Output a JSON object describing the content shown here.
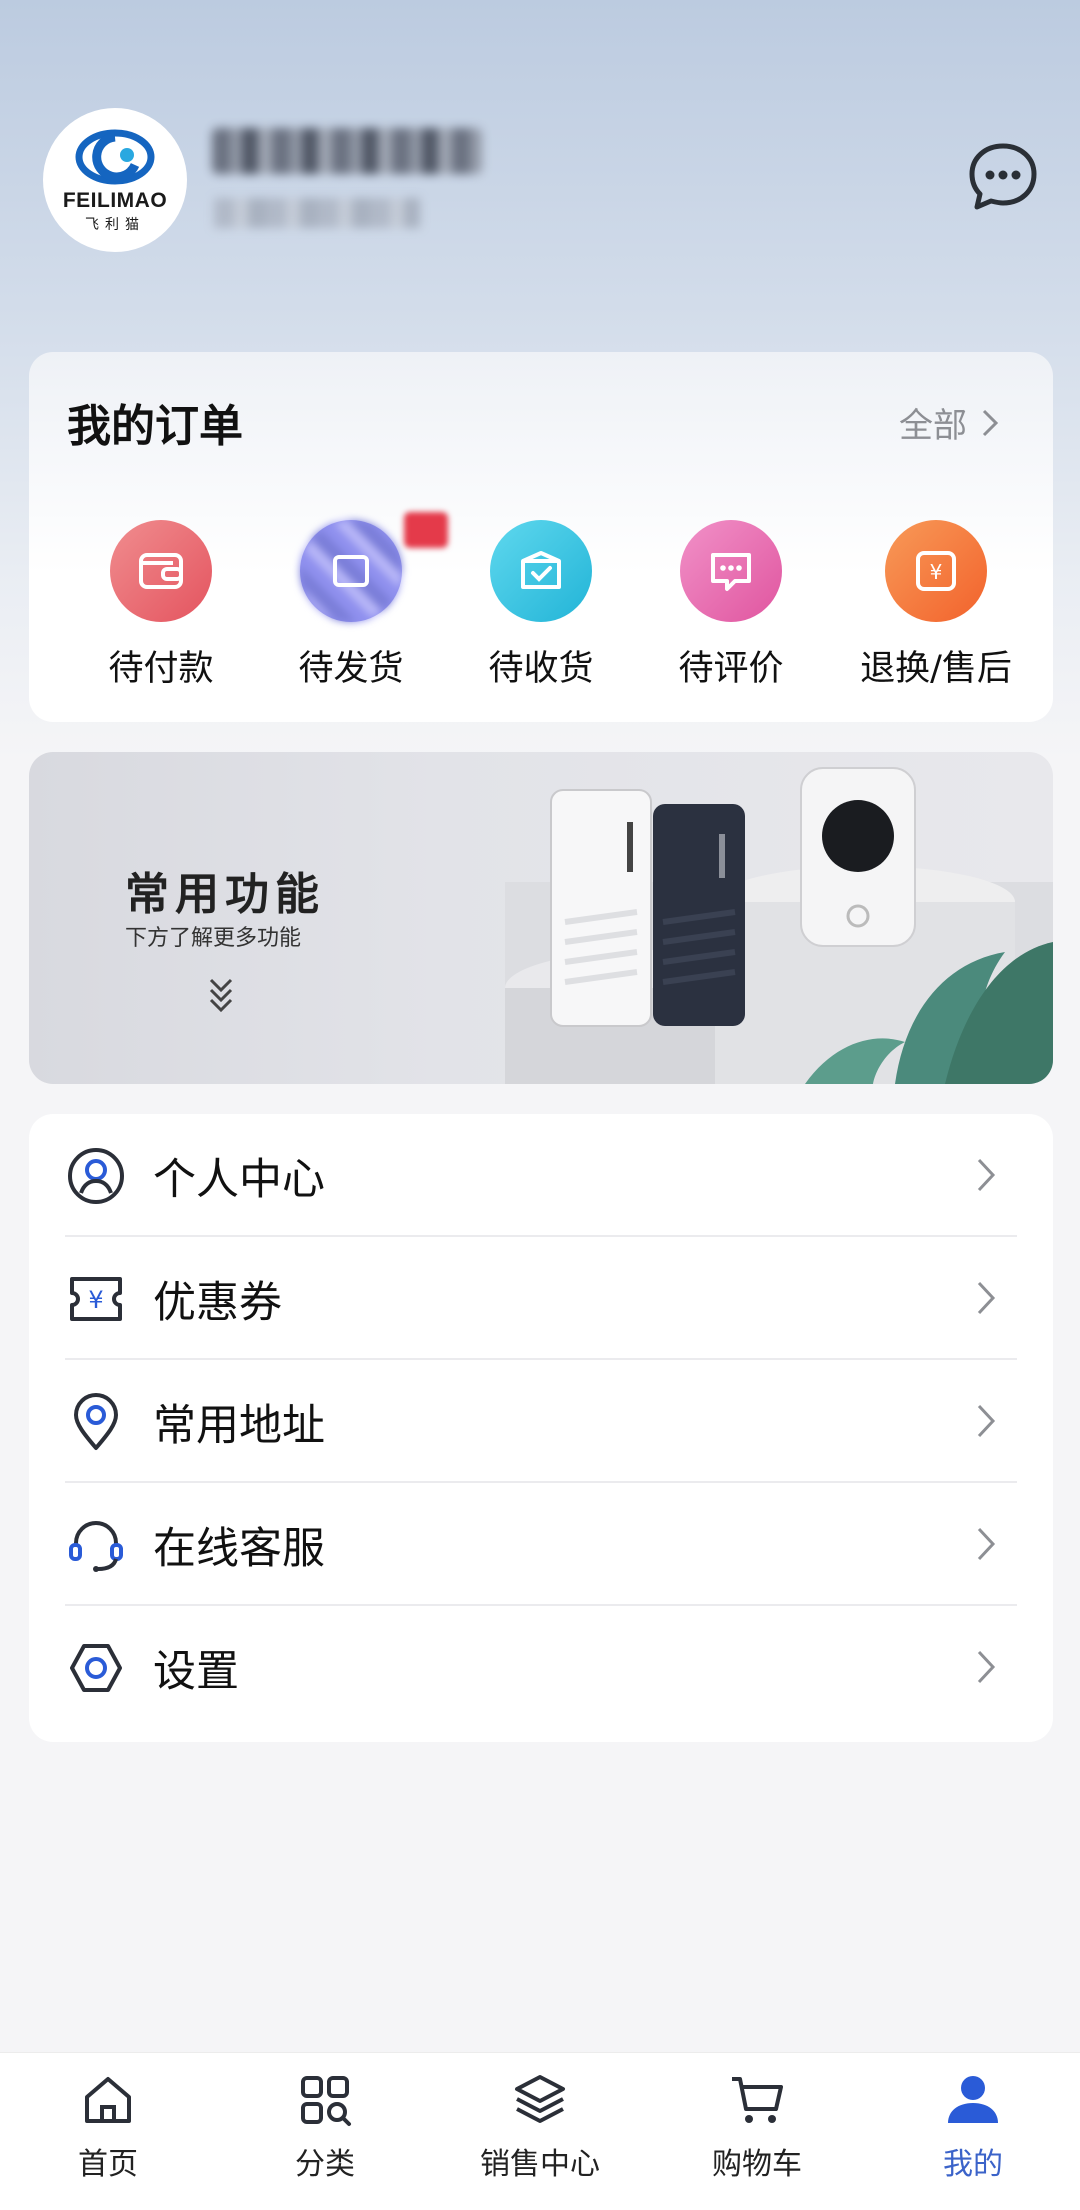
{
  "header": {
    "logo_text": "FEILIMAO",
    "logo_sub": "飞利猫",
    "message_icon": "chat-bubble-icon"
  },
  "orders": {
    "title": "我的订单",
    "all_label": "全部",
    "items": [
      {
        "label": "待付款",
        "icon": "wallet-icon",
        "color": "#ec6b73"
      },
      {
        "label": "待发货",
        "icon": "box-send-icon",
        "color": "#8f90ee"
      },
      {
        "label": "待收货",
        "icon": "box-check-icon",
        "color": "#37c7e3"
      },
      {
        "label": "待评价",
        "icon": "comment-icon",
        "color": "#ea6fb5"
      },
      {
        "label": "退换/售后",
        "icon": "refund-icon",
        "color": "#f57a3f"
      }
    ]
  },
  "banner": {
    "title": "常用功能",
    "subtitle": "下方了解更多功能"
  },
  "menu": {
    "items": [
      {
        "label": "个人中心",
        "icon": "user-circle-icon"
      },
      {
        "label": "优惠券",
        "icon": "coupon-icon"
      },
      {
        "label": "常用地址",
        "icon": "location-pin-icon"
      },
      {
        "label": "在线客服",
        "icon": "headset-icon"
      },
      {
        "label": "设置",
        "icon": "settings-hex-icon"
      }
    ]
  },
  "tabbar": {
    "active_color": "#3b63c9",
    "tabs": [
      {
        "label": "首页",
        "icon": "home-icon"
      },
      {
        "label": "分类",
        "icon": "category-grid-icon"
      },
      {
        "label": "销售中心",
        "icon": "layers-icon"
      },
      {
        "label": "购物车",
        "icon": "cart-icon"
      },
      {
        "label": "我的",
        "icon": "person-icon"
      }
    ]
  }
}
